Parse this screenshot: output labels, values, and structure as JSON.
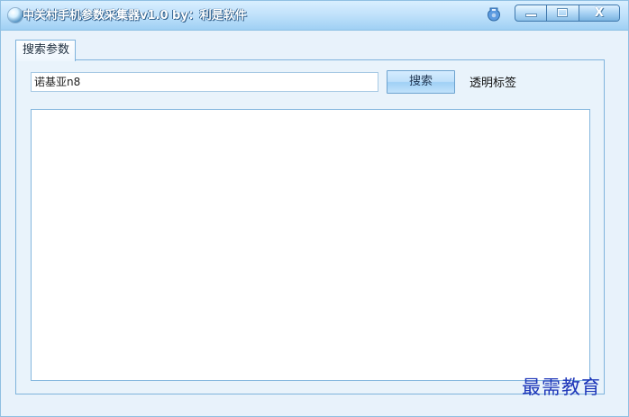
{
  "window": {
    "title": "中关村手机参数采集器v1.0  by：利是软件",
    "icon": "app-icon",
    "skin_icon": "skin-icon",
    "controls": {
      "minimize_icon": "minimize-icon",
      "maximize_icon": "maximize-icon",
      "close_icon": "close-icon",
      "close_label": "X"
    }
  },
  "tabs": [
    {
      "label": "搜索参数",
      "selected": true
    }
  ],
  "search": {
    "value": "诺基亚n8",
    "button_label": "搜索",
    "side_label": "透明标签"
  },
  "results": {
    "items": []
  },
  "watermark": {
    "text": "最需教育"
  },
  "colors": {
    "title_bar": "#c2e2fb",
    "panel": "#e8f2fb",
    "border": "#7fb3dc",
    "button": "#bfe0fa",
    "watermark": "#1d36b9"
  }
}
